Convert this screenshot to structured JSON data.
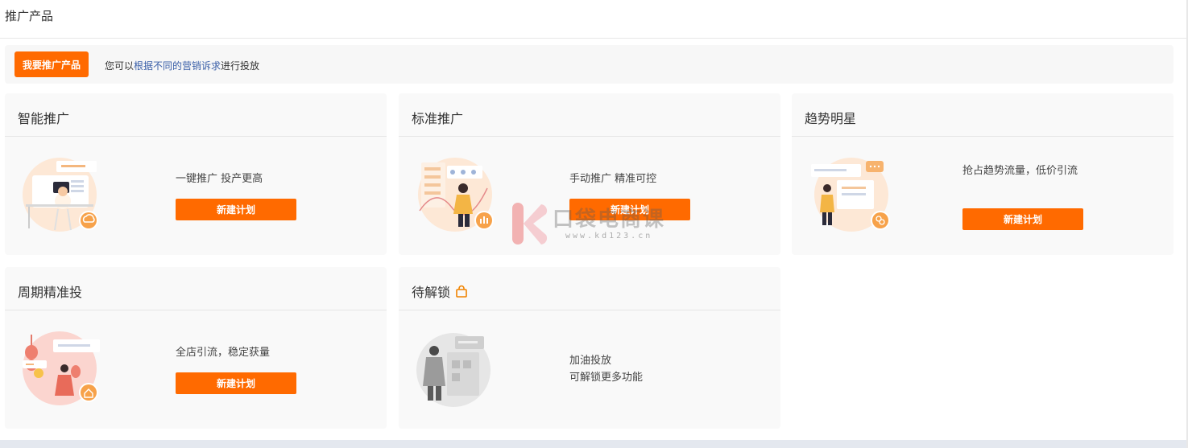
{
  "header": {
    "title": "推广产品"
  },
  "banner": {
    "button_label": "我要推广产品",
    "desc_prefix": "您可以",
    "desc_link": "根据不同的营销诉求",
    "desc_suffix": "进行投放"
  },
  "cards": [
    {
      "title": "智能推广",
      "desc": "一键推广 投产更高",
      "button": "新建计划",
      "badge_icon": "cloud-refresh-icon"
    },
    {
      "title": "标准推广",
      "desc": "手动推广 精准可控",
      "button": "新建计划",
      "badge_icon": "bar-chart-icon"
    },
    {
      "title": "趋势明星",
      "desc": "抢占趋势流量，低价引流",
      "button": "新建计划",
      "badge_icon": "coins-icon"
    },
    {
      "title": "周期精准投",
      "desc": "全店引流，稳定获量",
      "button": "新建计划",
      "badge_icon": "home-icon"
    },
    {
      "title": "待解锁",
      "desc_line1": "加油投放",
      "desc_line2": "可解锁更多功能",
      "title_icon": "lock-icon"
    }
  ],
  "watermark": {
    "text": "口袋电商课",
    "url": "www.kd123.cn"
  },
  "colors": {
    "accent": "#ff6a00",
    "link": "#3a5fa8",
    "card_bg": "#f9f9f9"
  }
}
